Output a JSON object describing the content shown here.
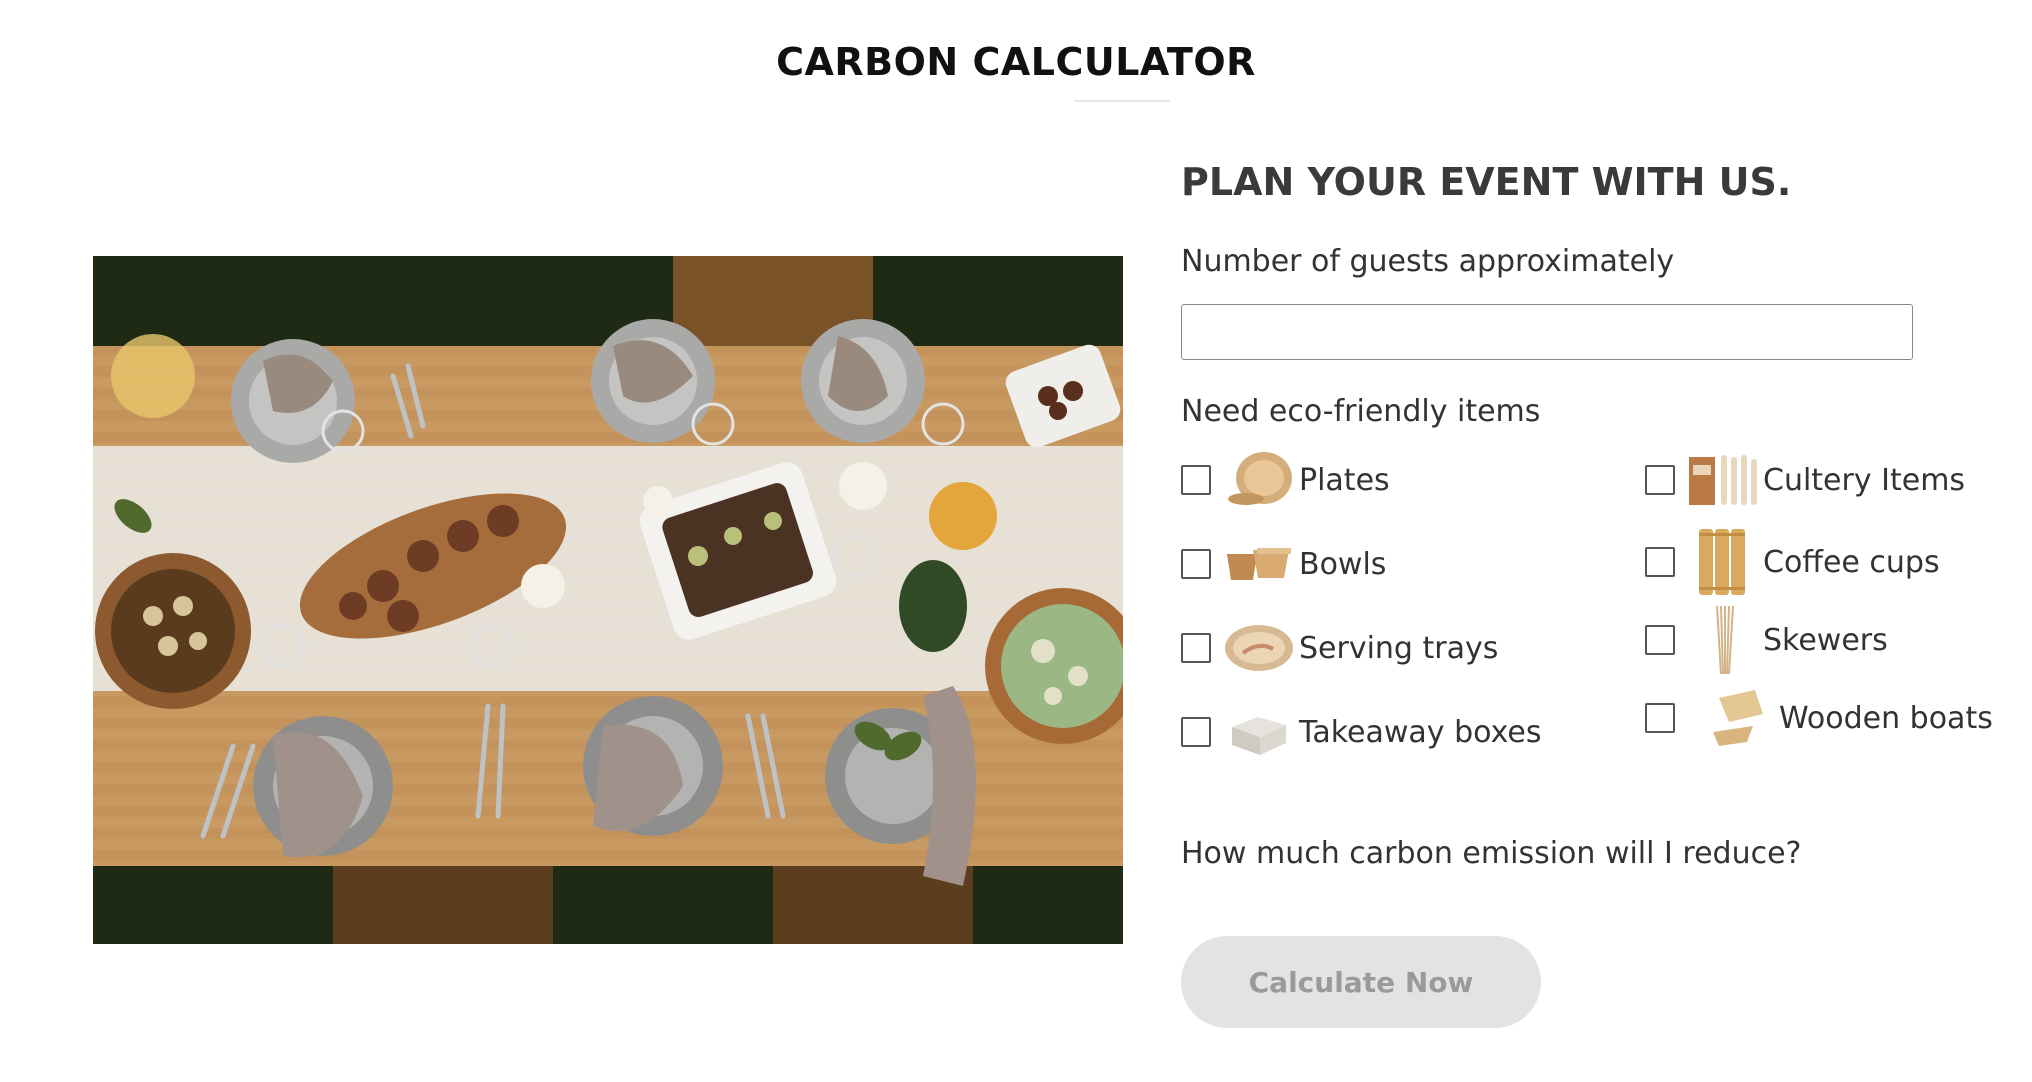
{
  "page": {
    "title": "CARBON CALCULATOR"
  },
  "hero_image": {
    "alt": "Top-down view of a dining table set with plates, napkins, salads and dishes"
  },
  "form": {
    "heading": "PLAN YOUR EVENT WITH US.",
    "guests_label": "Number of guests approximately",
    "guests_value": "",
    "guests_placeholder": "",
    "items_label": "Need eco-friendly items",
    "options_left": [
      {
        "label": "Plates",
        "icon": "plate-icon",
        "checked": false
      },
      {
        "label": "Bowls",
        "icon": "bowl-icon",
        "checked": false
      },
      {
        "label": "Serving trays",
        "icon": "tray-icon",
        "checked": false
      },
      {
        "label": "Takeaway boxes",
        "icon": "box-icon",
        "checked": false
      }
    ],
    "options_right": [
      {
        "label": "Cultery Items",
        "icon": "cutlery-icon",
        "checked": false
      },
      {
        "label": "Coffee cups",
        "icon": "cup-icon",
        "checked": false
      },
      {
        "label": "Skewers",
        "icon": "skewer-icon",
        "checked": false
      },
      {
        "label": "Wooden boats",
        "icon": "boat-icon",
        "checked": false
      }
    ],
    "question": "How much carbon emission will I reduce?",
    "calculate_label": "Calculate Now"
  },
  "colors": {
    "button_bg": "#e3e3e3",
    "button_text": "#9a9a9a",
    "heading_text": "#3a3a3a",
    "wood": "#c89a62"
  }
}
